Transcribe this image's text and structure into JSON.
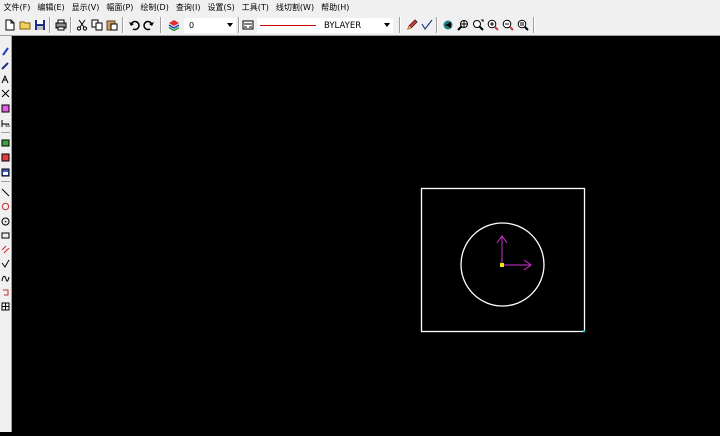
{
  "menu": [
    {
      "label": "文件(F)"
    },
    {
      "label": "编辑(E)"
    },
    {
      "label": "显示(V)"
    },
    {
      "label": "幅面(P)"
    },
    {
      "label": "绘制(D)"
    },
    {
      "label": "查询(I)"
    },
    {
      "label": "设置(S)"
    },
    {
      "label": "工具(T)"
    },
    {
      "label": "线切割(W)"
    },
    {
      "label": "帮助(H)"
    }
  ],
  "toolbar": {
    "layer_value": "0",
    "linetype_value": "BYLAYER"
  },
  "colors": {
    "canvas_bg": "#000000",
    "entity": "#ffffff",
    "ucs_axis": "#cc33cc",
    "origin_marker": "#e8e800",
    "corner_marker": "#00cccc",
    "linetype_swatch": "#cc0000"
  }
}
